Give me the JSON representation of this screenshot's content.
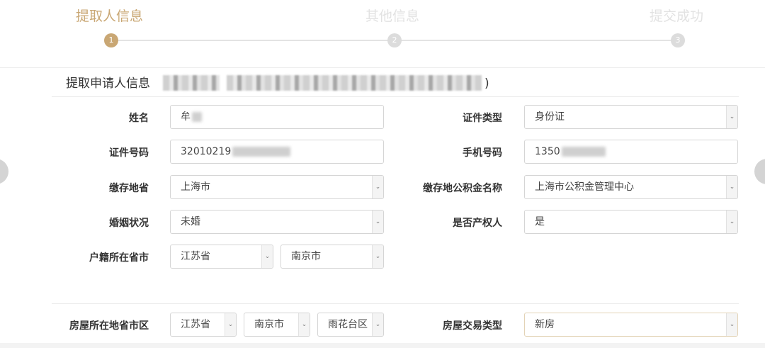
{
  "stepper": {
    "steps": [
      {
        "label": "提取人信息",
        "number": "1",
        "state": "active"
      },
      {
        "label": "其他信息",
        "number": "2",
        "state": "inactive"
      },
      {
        "label": "提交成功",
        "number": "3",
        "state": "inactive"
      }
    ]
  },
  "section": {
    "title": "提取申请人信息",
    "closing_paren": ")"
  },
  "form": {
    "name": {
      "label": "姓名",
      "value": "牟"
    },
    "id_type": {
      "label": "证件类型",
      "value": "身份证"
    },
    "id_number": {
      "label": "证件号码",
      "value": "32010219"
    },
    "phone": {
      "label": "手机号码",
      "value": "1350"
    },
    "deposit_province": {
      "label": "缴存地省",
      "value": "上海市"
    },
    "fund_name": {
      "label": "缴存地公积金名称",
      "value": "上海市公积金管理中心"
    },
    "marital": {
      "label": "婚姻状况",
      "value": "未婚"
    },
    "is_owner": {
      "label": "是否产权人",
      "value": "是"
    },
    "household": {
      "label": "户籍所在省市",
      "province": "江苏省",
      "city": "南京市"
    },
    "house_location": {
      "label": "房屋所在地省市区",
      "province": "江苏省",
      "city": "南京市",
      "district": "雨花台区"
    },
    "trade_type": {
      "label": "房屋交易类型",
      "value": "新房"
    }
  },
  "colors": {
    "accent": "#c9a774",
    "inactive": "#dcdcdc",
    "border": "#d5d5d5"
  },
  "icons": {
    "caret": "chevron-down-icon"
  }
}
